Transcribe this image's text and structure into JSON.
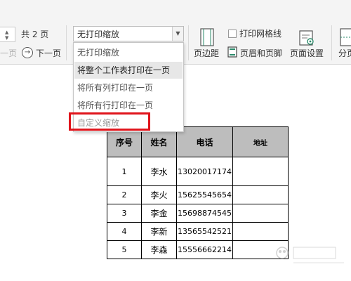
{
  "toolbar": {
    "page_total": "共 2 页",
    "prev_page": "一页",
    "next_page": "下一页",
    "scale_value": "无打印缩放",
    "margins": "页边距",
    "print_gridlines": "打印网格线",
    "header_footer": "页眉和页脚",
    "page_setup": "页面设置",
    "page_break": "分页"
  },
  "dropdown": {
    "items": [
      {
        "label": "无打印缩放"
      },
      {
        "label": "将整个工作表打印在一页"
      },
      {
        "label": "将所有列打印在一页"
      },
      {
        "label": "将所有行打印在一页"
      },
      {
        "label": "自定义缩放"
      }
    ]
  },
  "table": {
    "headers": [
      "序号",
      "姓名",
      "电话",
      "地址"
    ],
    "rows": [
      [
        "1",
        "李水",
        "13020017174",
        ""
      ],
      [
        "2",
        "李火",
        "15625545654",
        ""
      ],
      [
        "3",
        "李金",
        "15698874545",
        ""
      ],
      [
        "4",
        "李新",
        "13565542521",
        ""
      ],
      [
        "5",
        "李森",
        "15556662214",
        ""
      ]
    ]
  },
  "colors": {
    "highlight": "#e0141b",
    "header_fill": "#bdbdbd"
  }
}
